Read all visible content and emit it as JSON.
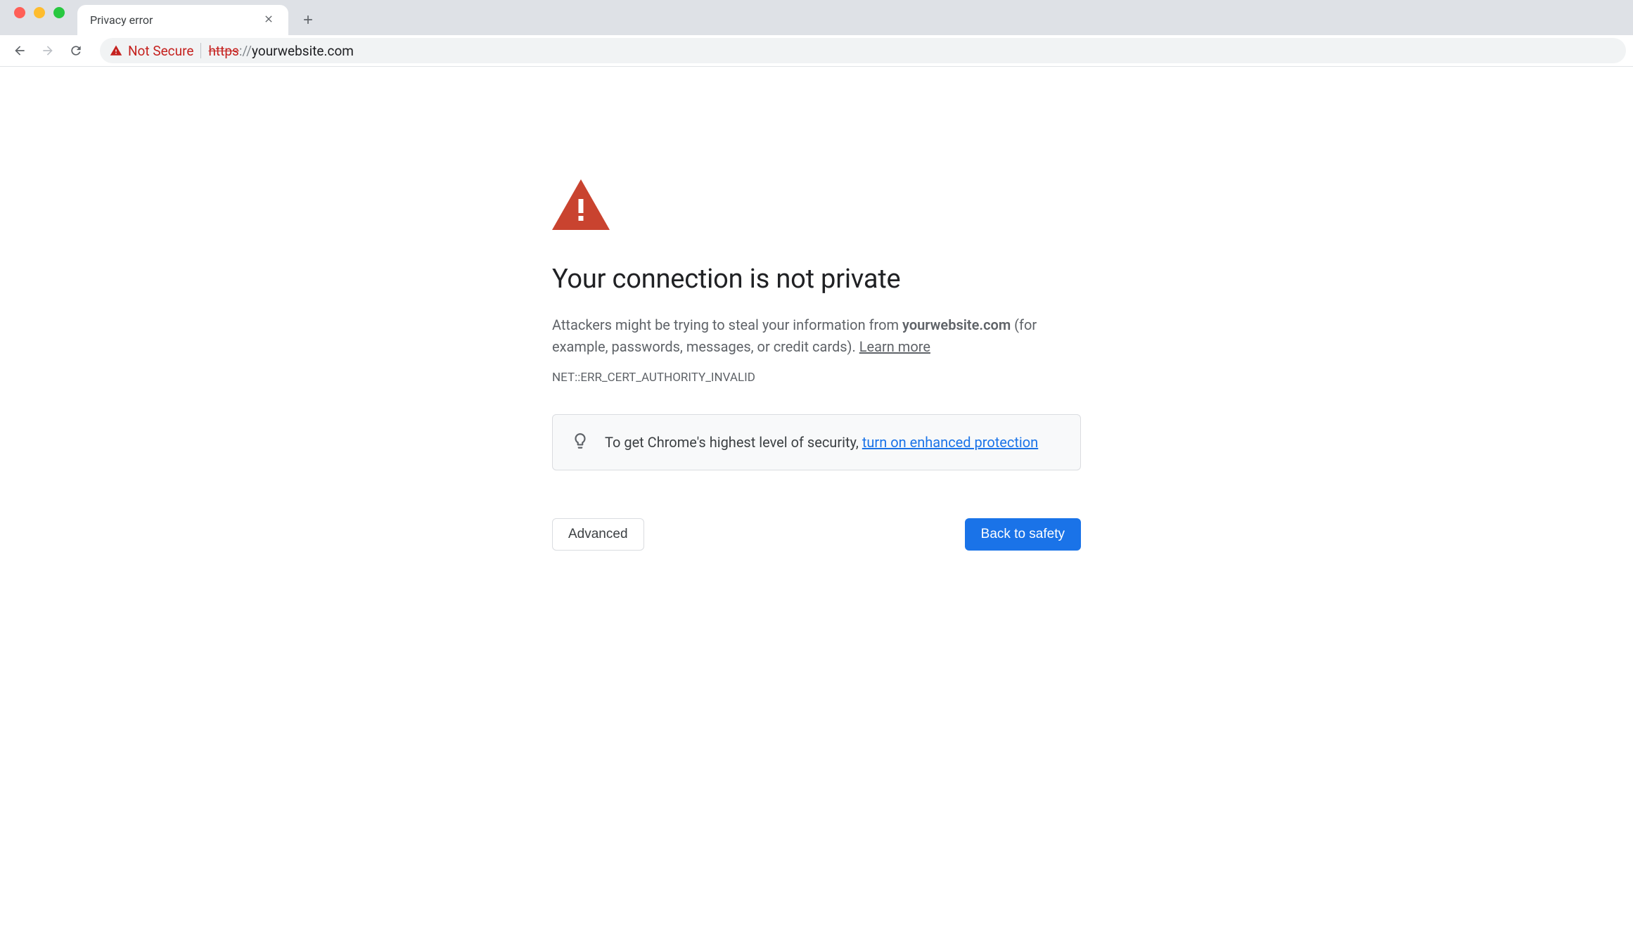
{
  "tab": {
    "title": "Privacy error"
  },
  "toolbar": {
    "security_label": "Not Secure",
    "url": {
      "scheme": "https",
      "separator": "://",
      "rest": "yourwebsite.com"
    }
  },
  "interstitial": {
    "heading": "Your connection is not private",
    "body_pre": "Attackers might be trying to steal your information from ",
    "domain": "yourwebsite.com",
    "body_post": " (for example, passwords, messages, or credit cards). ",
    "learn_more": "Learn more",
    "error_code": "NET::ERR_CERT_AUTHORITY_INVALID",
    "tip_pre": "To get Chrome's highest level of security, ",
    "tip_link": "turn on enhanced protection",
    "advanced_label": "Advanced",
    "back_label": "Back to safety"
  }
}
